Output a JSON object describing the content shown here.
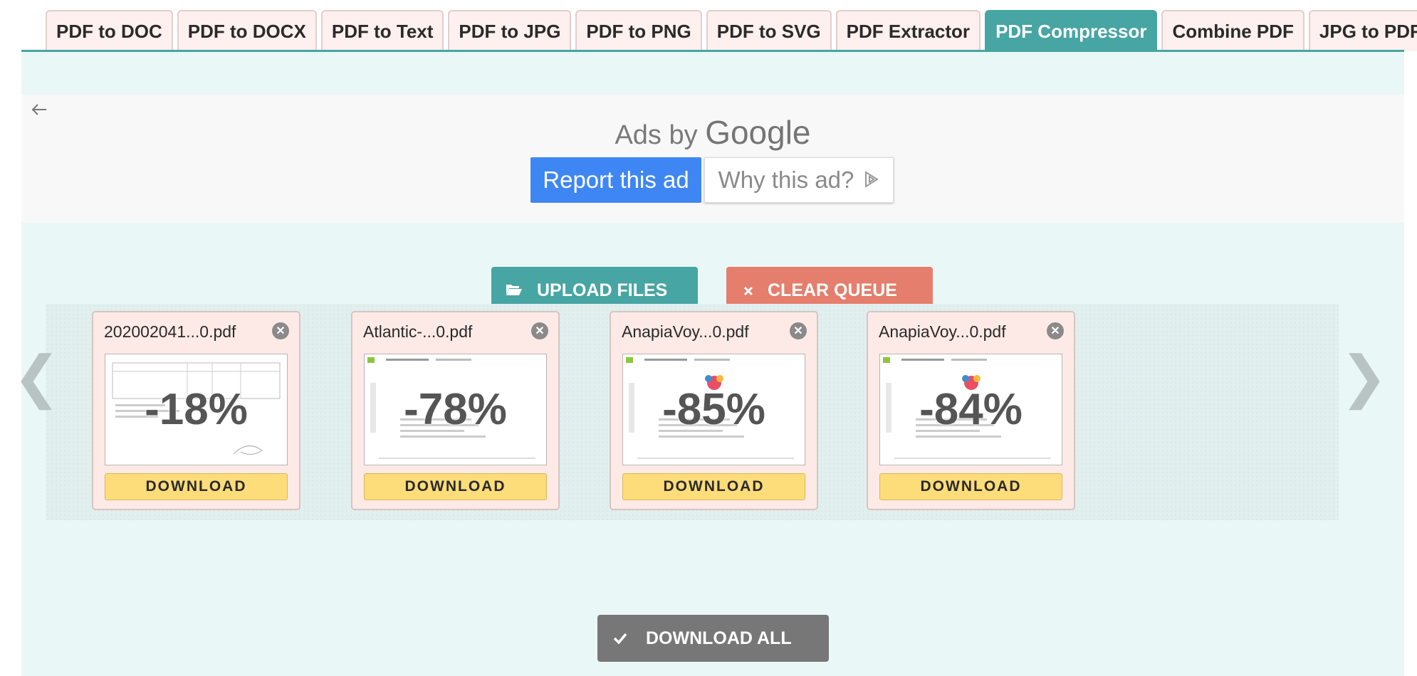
{
  "tabs": [
    {
      "label": "PDF to DOC",
      "active": false
    },
    {
      "label": "PDF to DOCX",
      "active": false
    },
    {
      "label": "PDF to Text",
      "active": false
    },
    {
      "label": "PDF to JPG",
      "active": false
    },
    {
      "label": "PDF to PNG",
      "active": false
    },
    {
      "label": "PDF to SVG",
      "active": false
    },
    {
      "label": "PDF Extractor",
      "active": false
    },
    {
      "label": "PDF Compressor",
      "active": true
    },
    {
      "label": "Combine PDF",
      "active": false
    },
    {
      "label": "JPG to PDF",
      "active": false
    }
  ],
  "ad": {
    "prefix": "Ads by ",
    "brand": "Google",
    "report_label": "Report this ad",
    "why_label": "Why this ad?"
  },
  "actions": {
    "upload_label": "UPLOAD FILES",
    "clear_label": "CLEAR QUEUE",
    "download_all_label": "DOWNLOAD ALL"
  },
  "navigation": {
    "prev": "❮",
    "next": "❯"
  },
  "files": [
    {
      "name": "202002041...0.pdf",
      "reduction": "-18%",
      "download_label": "DOWNLOAD"
    },
    {
      "name": "Atlantic-...0.pdf",
      "reduction": "-78%",
      "download_label": "DOWNLOAD"
    },
    {
      "name": "AnapiaVoy...0.pdf",
      "reduction": "-85%",
      "download_label": "DOWNLOAD"
    },
    {
      "name": "AnapiaVoy...0.pdf",
      "reduction": "-84%",
      "download_label": "DOWNLOAD"
    }
  ],
  "colors": {
    "accent": "#47a5a3",
    "clear": "#e57e6c",
    "download": "#fddc7a",
    "report": "#3f86f5"
  }
}
